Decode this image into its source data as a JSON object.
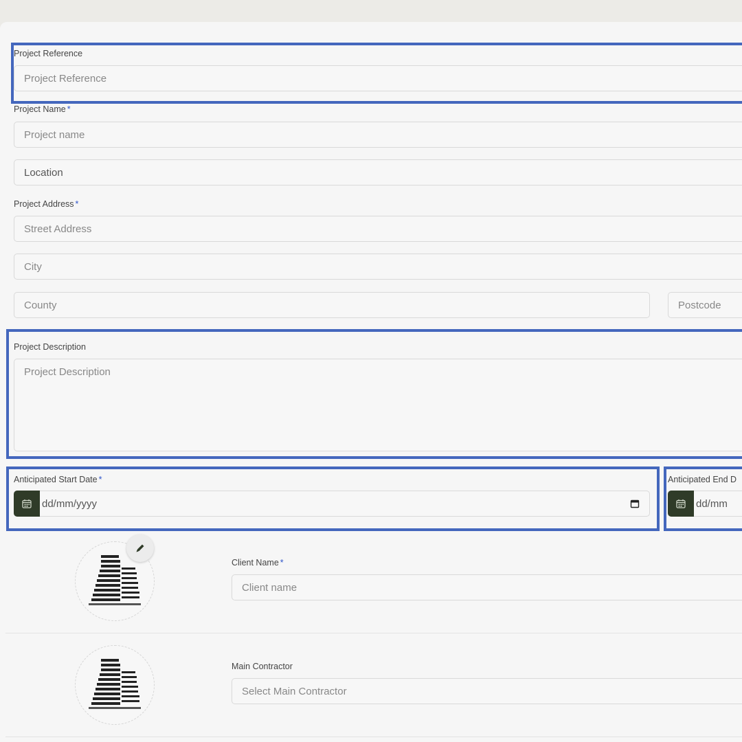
{
  "form": {
    "project_reference": {
      "label": "Project Reference",
      "placeholder": "Project Reference"
    },
    "project_name": {
      "label": "Project Name",
      "required_mark": "*",
      "placeholder": "Project name"
    },
    "location": {
      "value": "Location"
    },
    "project_address": {
      "label": "Project Address",
      "required_mark": "*",
      "street_placeholder": "Street Address",
      "city_placeholder": "City",
      "county_placeholder": "County",
      "postcode_placeholder": "Postcode"
    },
    "project_description": {
      "label": "Project Description",
      "placeholder": "Project Description"
    },
    "start_date": {
      "label": "Anticipated Start Date",
      "required_mark": "*",
      "value": "dd/mm/yyyy"
    },
    "end_date": {
      "label": "Anticipated End D",
      "value": "dd/mm"
    },
    "client": {
      "label": "Client Name",
      "required_mark": "*",
      "placeholder": "Client name"
    },
    "main_contractor": {
      "label": "Main Contractor",
      "placeholder": "Select Main Contractor"
    }
  },
  "icons": {
    "calendar": "calendar-icon",
    "edit": "pencil-icon",
    "avatar": "buildings-icon"
  },
  "colors": {
    "highlight": "#4467bd",
    "required": "#2f55c9",
    "date_button": "#2f3b28"
  }
}
